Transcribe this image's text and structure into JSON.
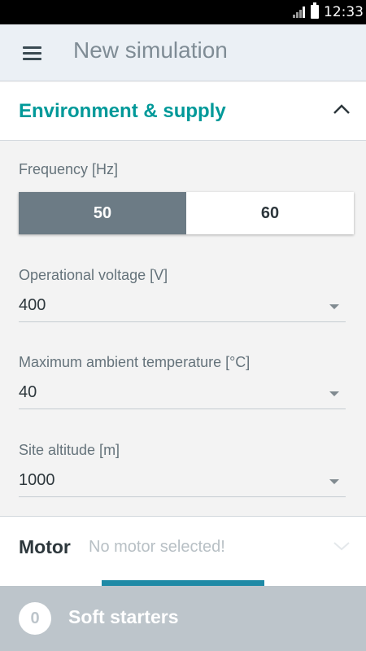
{
  "status_bar": {
    "time": "12:33"
  },
  "app_bar": {
    "title": "New simulation"
  },
  "environment": {
    "title": "Environment & supply",
    "frequency": {
      "label": "Frequency [Hz]",
      "options": [
        "50",
        "60"
      ],
      "selected": "50"
    },
    "voltage": {
      "label": "Operational voltage [V]",
      "value": "400"
    },
    "temperature": {
      "label": "Maximum ambient temperature [°C]",
      "value": "40"
    },
    "altitude": {
      "label": "Site altitude [m]",
      "value": "1000"
    }
  },
  "motor": {
    "title": "Motor",
    "status": "No motor selected!"
  },
  "bottom_bar": {
    "count": "0",
    "title": "Soft starters"
  },
  "colors": {
    "accent": "#009999",
    "selected_segment": "#6c7b85",
    "bottom_bar": "#bdc5cb"
  }
}
